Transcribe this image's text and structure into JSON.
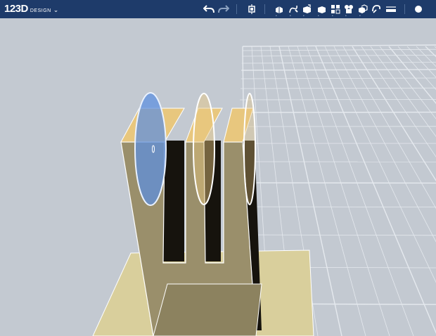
{
  "app": {
    "logo_main": "123D",
    "logo_sub": "DESIGN",
    "menu_chevron": "⌄"
  },
  "toolbar": {
    "tools": [
      {
        "name": "undo-icon"
      },
      {
        "name": "redo-icon"
      },
      {
        "name": "transform-icon"
      },
      {
        "name": "primitives-icon"
      },
      {
        "name": "sketch-icon"
      },
      {
        "name": "construct-icon"
      },
      {
        "name": "modify-icon"
      },
      {
        "name": "pattern-icon"
      },
      {
        "name": "grouping-icon"
      },
      {
        "name": "combine-icon"
      },
      {
        "name": "snap-icon"
      },
      {
        "name": "measure-icon"
      },
      {
        "name": "material-icon"
      }
    ]
  },
  "colors": {
    "toolbar_bg": "#1e3b6a",
    "viewport_bg": "#c3c9d1",
    "grid_line": "#e9edf2",
    "base_plate": "#d9cf9c",
    "part_face": "#9a8f6b",
    "part_top": "#e8c77e",
    "part_shadow": "#16130d",
    "selected_disc": "#5b8fe0"
  },
  "scene": {
    "objects": [
      {
        "name": "base-plate"
      },
      {
        "name": "comb-part"
      },
      {
        "name": "disc-selected",
        "selected": true
      },
      {
        "name": "disc-middle",
        "selected": false
      },
      {
        "name": "disc-right",
        "selected": false
      }
    ]
  }
}
